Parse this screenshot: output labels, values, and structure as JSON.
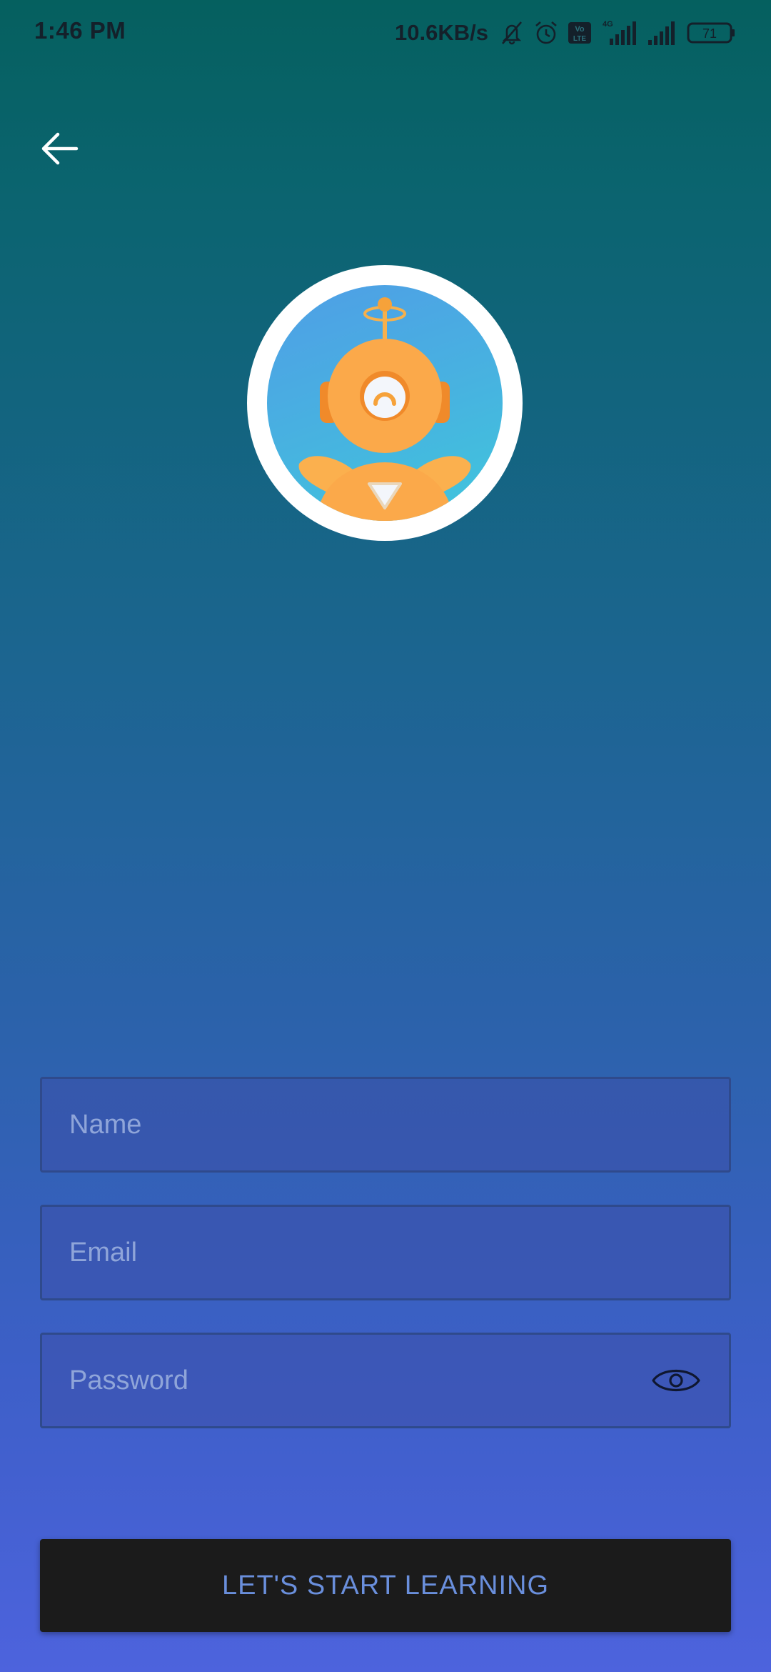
{
  "status_bar": {
    "time": "1:46 PM",
    "net_speed": "10.6KB/s",
    "network_type": "4G",
    "volte_label": "Vo LTE",
    "battery_level": "71",
    "icons": [
      "mute-icon",
      "alarm-icon",
      "volte-icon",
      "signal-icon",
      "signal-icon",
      "battery-icon"
    ]
  },
  "header": {
    "back_icon": "arrow-left-icon"
  },
  "avatar": {
    "icon": "robot-mascot"
  },
  "form": {
    "name_placeholder": "Name",
    "email_placeholder": "Email",
    "password_placeholder": "Password",
    "password_toggle_icon": "eye-icon",
    "submit_label": "LET'S START LEARNING"
  },
  "colors": {
    "gradient_top": "#05605f",
    "gradient_bottom": "#4d63dd",
    "field_border": "#2f4a8c",
    "placeholder": "#8fa5d9",
    "button_bg": "#1b1b1b",
    "button_text": "#6a8fdc",
    "mascot_orange": "#fba94a"
  }
}
